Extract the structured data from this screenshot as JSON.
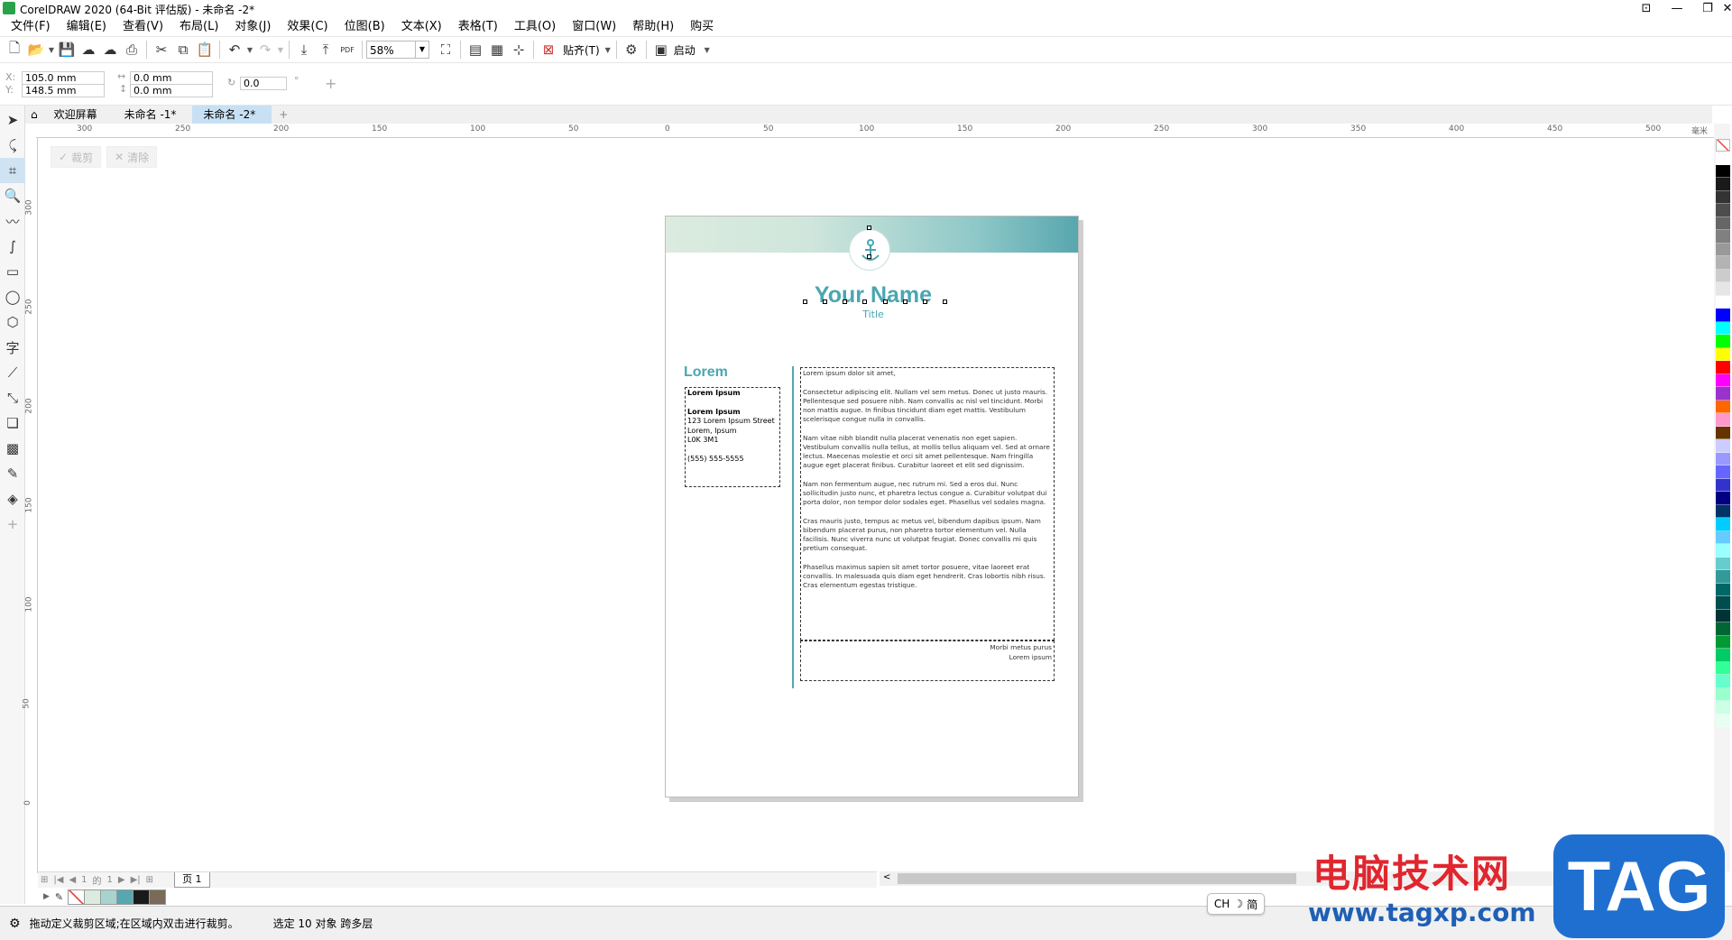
{
  "app": {
    "title": "CorelDRAW 2020 (64-Bit 评估版) - 未命名 -2*",
    "window_buttons": [
      "account-icon",
      "minimize-icon",
      "restore-icon",
      "close-icon"
    ]
  },
  "menubar": {
    "items": [
      {
        "label": "文件(F)"
      },
      {
        "label": "编辑(E)"
      },
      {
        "label": "查看(V)"
      },
      {
        "label": "布局(L)"
      },
      {
        "label": "对象(J)"
      },
      {
        "label": "效果(C)"
      },
      {
        "label": "位图(B)"
      },
      {
        "label": "文本(X)"
      },
      {
        "label": "表格(T)"
      },
      {
        "label": "工具(O)"
      },
      {
        "label": "窗口(W)"
      },
      {
        "label": "帮助(H)"
      },
      {
        "label": "购买"
      }
    ]
  },
  "toolbar": {
    "zoom": "58%",
    "snap_label": "贴齐(T)",
    "launch_label": "启动",
    "pdf_label": "PDF"
  },
  "propbar": {
    "x_label": "X:",
    "y_label": "Y:",
    "x_value": "105.0 mm",
    "y_value": "148.5 mm",
    "w_value": "0.0 mm",
    "h_value": "0.0 mm",
    "angle_value": "0.0",
    "degree": "°"
  },
  "doc_tabs": {
    "home_icon": "home-icon",
    "items": [
      {
        "label": "欢迎屏幕"
      },
      {
        "label": "未命名 -1*"
      },
      {
        "label": "未命名 -2*"
      }
    ],
    "add": "+"
  },
  "crop_actions": {
    "crop": "裁剪",
    "clear": "清除"
  },
  "rulers": {
    "h_ticks": [
      "300",
      "250",
      "200",
      "150",
      "100",
      "50",
      "0",
      "50",
      "100",
      "150",
      "200",
      "250",
      "300",
      "350",
      "400",
      "450",
      "500"
    ],
    "h_unit": "毫米",
    "v_ticks": [
      "300",
      "250",
      "200",
      "150",
      "100",
      "50",
      "0"
    ]
  },
  "page": {
    "name": "Your Name",
    "title": "Title",
    "lorem_heading": "Lorem",
    "left_box": [
      {
        "text": "Lorem Ipsum",
        "bold": true
      },
      {
        "text": "",
        "bold": false
      },
      {
        "text": "Lorem Ipsum",
        "bold": true
      },
      {
        "text": "123 Lorem Ipsum Street",
        "bold": false
      },
      {
        "text": "Lorem, Ipsum",
        "bold": false
      },
      {
        "text": "L0K 3M1",
        "bold": false
      },
      {
        "text": "",
        "bold": false
      },
      {
        "text": "(555) 555-5555",
        "bold": false
      }
    ],
    "main_paragraphs": [
      "Lorem ipsum dolor sit amet,",
      "Consectetur adipiscing elit. Nullam vel sem metus. Donec ut justo mauris. Pellentesque sed posuere nibh. Nam convallis ac nisl vel tincidunt. Morbi non mattis augue. In finibus tincidunt diam eget mattis. Vestibulum scelerisque congue nulla in convallis.",
      "Nam vitae nibh blandit nulla placerat venenatis non eget sapien. Vestibulum convallis nulla tellus, at mollis tellus aliquam vel. Sed at ornare lectus. Maecenas molestie et orci sit amet pellentesque. Nam fringilla augue eget placerat finibus. Curabitur laoreet et elit sed dignissim.",
      "Nam non fermentum augue, nec rutrum mi. Sed a eros dui. Nunc sollicitudin justo nunc, et pharetra lectus congue a. Curabitur volutpat dui porta dolor, non tempor dolor sodales eget. Phasellus vel sodales magna.",
      "Cras mauris justo, tempus ac metus vel, bibendum dapibus ipsum. Nam bibendum placerat purus, non pharetra tortor elementum vel. Nulla facilisis. Nunc viverra nunc ut volutpat feugiat. Donec convallis mi quis pretium consequat.",
      "Phasellus maximus sapien sit amet tortor posuere, vitae laoreet erat convallis. In malesuada quis diam eget hendrerit. Cras lobortis nibh risus. Cras elementum egestas tristique."
    ],
    "footer_lines": [
      "Morbi metus purus",
      "Lorem ipsum"
    ]
  },
  "page_nav": {
    "current": "1",
    "of": "的",
    "total": "1",
    "page_tab": "页 1"
  },
  "status": {
    "hint": "拖动定义裁剪区域;在区域内双击进行裁剪。",
    "selection": "选定 10 对象 跨多层",
    "ime": "CH",
    "ime_mode": "简"
  },
  "watermark": {
    "text": "电脑技术网",
    "url": "www.tagxp.com",
    "tag": "TAG"
  },
  "colors": {
    "accent": "#57a7ae",
    "name_color": "#4aa6b1",
    "band_light": "#dcebdf",
    "palette": [
      "#ffffff",
      "#000000",
      "#1a1a1a",
      "#333333",
      "#4d4d4d",
      "#666666",
      "#808080",
      "#999999",
      "#b3b3b3",
      "#cccccc",
      "#e6e6e6",
      "#ffffff",
      "#0000ff",
      "#00ffff",
      "#00ff00",
      "#ffff00",
      "#ff0000",
      "#ff00ff",
      "#9933cc",
      "#ff6600",
      "#ff99cc",
      "#663300",
      "#ccccff",
      "#9999ff",
      "#6666ff",
      "#3333cc",
      "#000080",
      "#003366",
      "#00ccff",
      "#66ccff",
      "#99ffff",
      "#66cccc",
      "#339999",
      "#006666",
      "#004d4d",
      "#003333",
      "#006633",
      "#009933",
      "#00cc66",
      "#33ff99",
      "#66ffcc",
      "#99ffcc",
      "#ccffe6",
      "#e6fff2"
    ],
    "doc_palette": [
      "#ffffff",
      "#dcebdf",
      "#a9d3cf",
      "#57a7ae",
      "#1a1a1a",
      "#7a6a5a"
    ]
  }
}
